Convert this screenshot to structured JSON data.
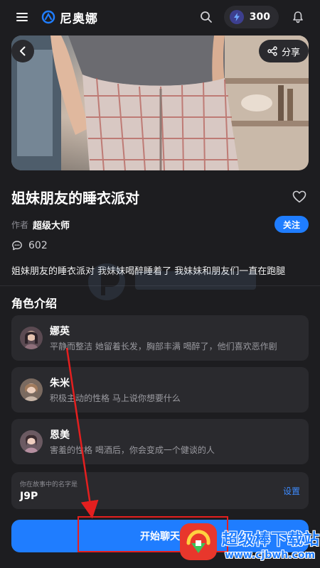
{
  "app": {
    "brand_name": "尼奥娜",
    "coins": "300"
  },
  "icons": {
    "menu": "hamburger-icon",
    "brand": "brand-logo-icon",
    "search": "search-icon",
    "coin": "lightning-icon",
    "bell": "bell-icon",
    "back": "chevron-left-icon",
    "share": "share-icon",
    "favorite": "heart-icon",
    "comments": "comment-icon"
  },
  "header": {
    "share_label": "分享"
  },
  "story": {
    "title": "姐妹朋友的睡衣派对",
    "author_label": "作者",
    "author_name": "超级大师",
    "follow_label": "关注",
    "comment_count": "602",
    "description": "姐妹朋友的睡衣派对 我妹妹喝醉睡着了 我妹妹和朋友们一直在跑腿"
  },
  "characters_section": {
    "title": "角色介绍",
    "items": [
      {
        "name": "娜英",
        "description": "平静而整洁 她留着长发，胸部丰满 喝醉了，他们喜欢恶作剧"
      },
      {
        "name": "朱米",
        "description": "积极主动的性格 马上说你想要什么"
      },
      {
        "name": "恩美",
        "description": "害羞的性格 喝酒后，你会变成一个健谈的人"
      }
    ]
  },
  "user_name": {
    "label": "你在故事中的名字是",
    "value": "J9P",
    "setting_label": "设置"
  },
  "start": {
    "label": "开始聊天"
  },
  "watermark": {
    "site_name": "超级棒下载站",
    "url": "www.cjbwh.com"
  },
  "colors": {
    "background": "#1d1d20",
    "card": "#2a2a2e",
    "accent": "#1f7dff",
    "annotation": "#e41f1f"
  }
}
